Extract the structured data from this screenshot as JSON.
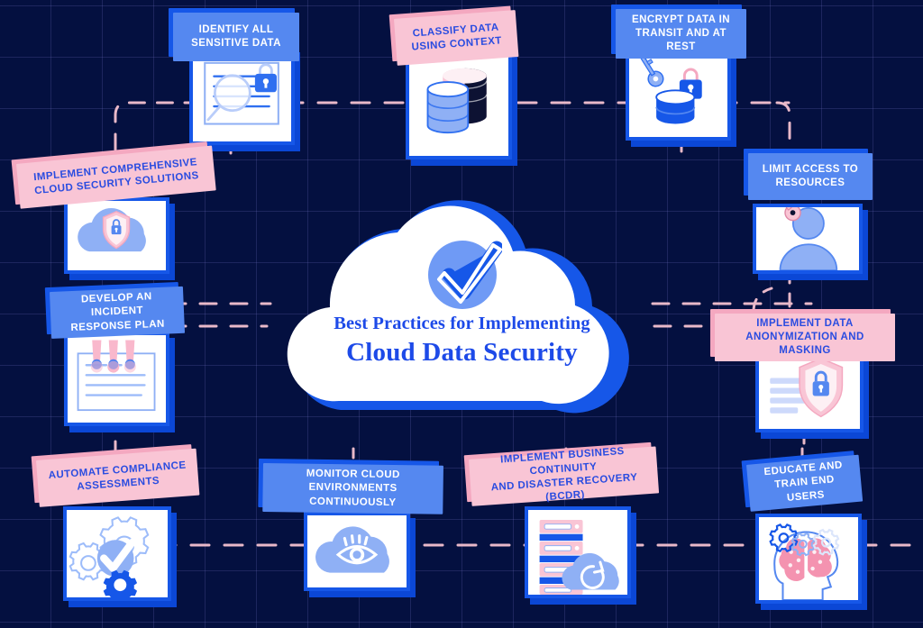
{
  "theme": {
    "background": "#041040",
    "grid_line": "#4a4e86",
    "blue_label_bg": "#5588f0",
    "blue_label_shadow": "#1657e8",
    "pink_label_bg": "#f9c5d5",
    "pink_label_shadow": "#f4a8c0",
    "label_text_blue": "#2a4ce0",
    "label_text_white": "#ffffff",
    "card_border": "#1657e8",
    "card_shadow": "#0b47d6",
    "card_bg": "#ffffff",
    "accent_blue": "#1d4ae8",
    "light_blue": "#8fb0f5",
    "pink": "#f9b8cc",
    "connector_line": "#e9b9c9"
  },
  "center": {
    "icon": "check-circle-icon",
    "subtitle": "Best Practices for Implementing",
    "title": "Cloud Data Security"
  },
  "nodes": [
    {
      "id": "identify-sensitive-data",
      "label": "IDENTIFY ALL\nSENSITIVE DATA",
      "label_color": "blue",
      "icon": "document-magnifier-lock-icon"
    },
    {
      "id": "classify-data-context",
      "label": "CLASSIFY DATA\nUSING CONTEXT",
      "label_color": "pink",
      "icon": "database-stack-icon"
    },
    {
      "id": "encrypt-data",
      "label": "ENCRYPT DATA IN\nTRANSIT AND AT REST",
      "label_color": "blue",
      "icon": "database-key-lock-icon"
    },
    {
      "id": "implement-cloud-security",
      "label": "IMPLEMENT COMPREHENSIVE\nCLOUD SECURITY SOLUTIONS",
      "label_color": "pink",
      "icon": "cloud-shield-lock-icon"
    },
    {
      "id": "limit-access",
      "label": "LIMIT ACCESS TO\nRESOURCES",
      "label_color": "blue",
      "icon": "user-key-icon"
    },
    {
      "id": "incident-response-plan",
      "label": "DEVELOP AN INCIDENT\nRESPONSE PLAN",
      "label_color": "blue",
      "icon": "document-alert-icon"
    },
    {
      "id": "data-anonymization",
      "label": "IMPLEMENT DATA\nANONYMIZATION AND MASKING",
      "label_color": "pink",
      "icon": "document-shield-lock-icon"
    },
    {
      "id": "automate-compliance",
      "label": "AUTOMATE COMPLIANCE\nASSESSMENTS",
      "label_color": "pink",
      "icon": "gears-check-icon"
    },
    {
      "id": "monitor-cloud",
      "label": "MONITOR CLOUD\nENVIRONMENTS CONTINUOUSLY",
      "label_color": "blue",
      "icon": "cloud-eye-icon"
    },
    {
      "id": "bcdr",
      "label": "IMPLEMENT BUSINESS CONTINUITY\nAND DISASTER RECOVERY (BCDR)",
      "label_color": "pink",
      "icon": "server-cloud-refresh-icon"
    },
    {
      "id": "educate-train-users",
      "label": "EDUCATE AND\nTRAIN END USERS",
      "label_color": "blue",
      "icon": "head-brain-gears-icon"
    }
  ]
}
